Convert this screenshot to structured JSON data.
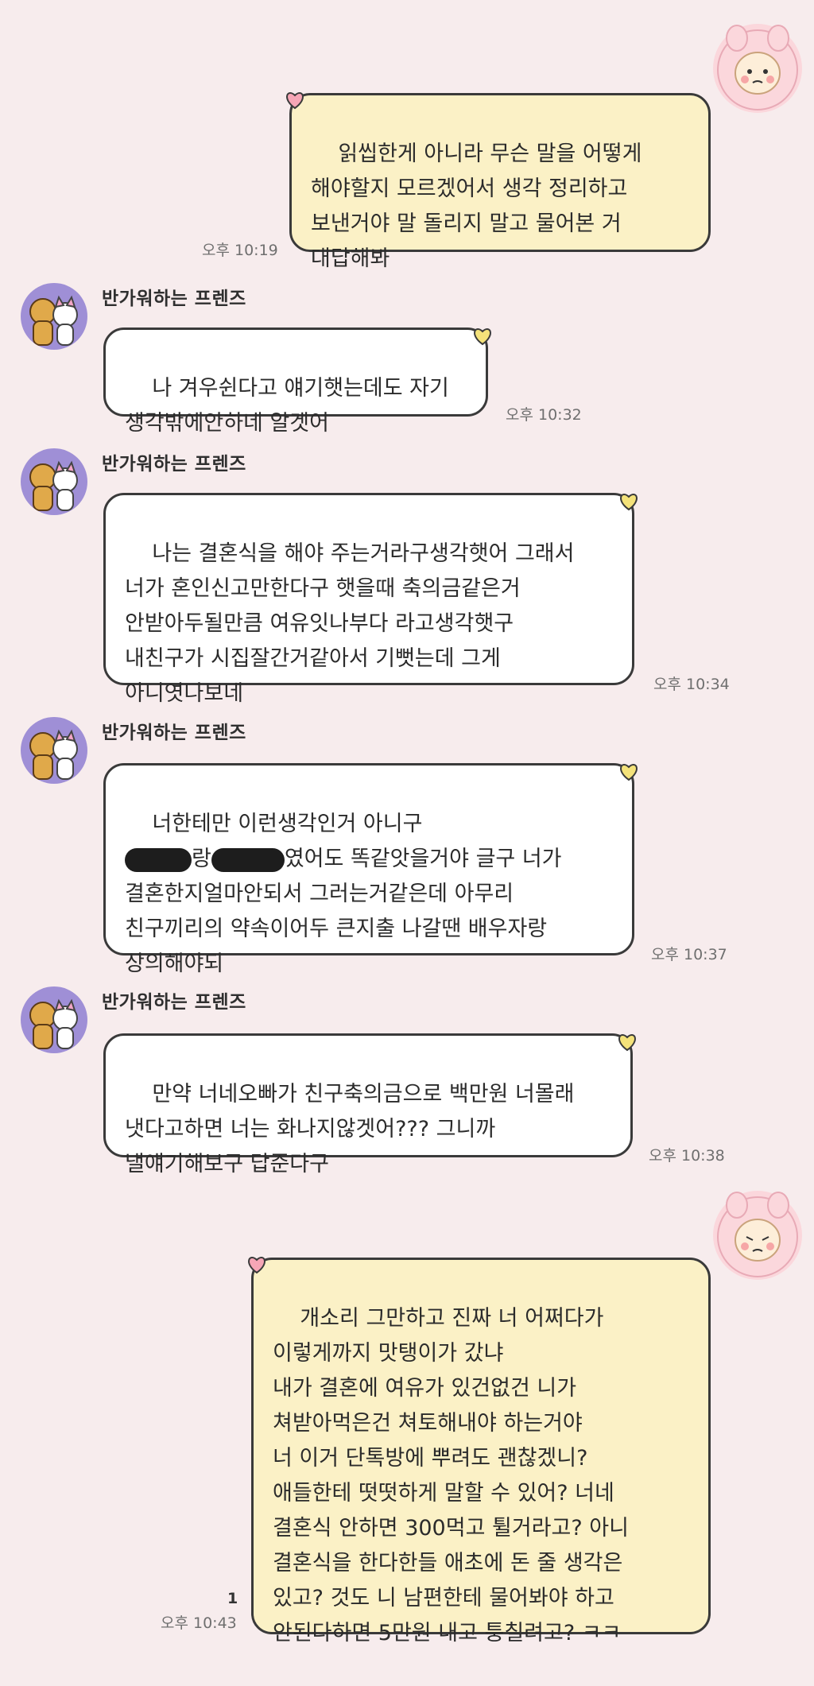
{
  "colors": {
    "background": "#f7eced",
    "my_bubble": "#fbf1c6",
    "friend_bubble": "#ffffff",
    "avatar_friend_bg": "#9f8fd6",
    "avatar_me_bg": "#fbd7dc",
    "heart_me": "#f6a6b6",
    "heart_friend": "#f4e27a"
  },
  "messages": [
    {
      "sender": "me",
      "avatar_icon": "pink-bunny-avatar-icon",
      "text": "읽씹한게 아니라 무슨 말을 어떻게\n해야할지 모르겠어서 생각 정리하고\n보낸거야 말 돌리지 말고 물어본 거\n대답해봐",
      "time": "오후 10:19"
    },
    {
      "sender": "friend",
      "name": "반가워하는 프렌즈",
      "avatar_icon": "friends-avatar-icon",
      "text": "나 겨우쉰다고 얘기햇는데도 자기\n생각밖에안하네 알겟어",
      "time": "오후 10:32"
    },
    {
      "sender": "friend",
      "name": "반가워하는 프렌즈",
      "avatar_icon": "friends-avatar-icon",
      "text": "나는 결혼식을 해야 주는거라구생각햇어 그래서\n너가 혼인신고만한다구 햇을때 축의금같은거\n안받아두될만큼 여유잇나부다 라고생각햇구\n내친구가 시집잘간거같아서 기뻣는데 그게\n아니엿나보네",
      "time": "오후 10:34"
    },
    {
      "sender": "friend",
      "name": "반가워하는 프렌즈",
      "avatar_icon": "friends-avatar-icon",
      "text_line1": "너한테만 이런생각인거 아니구",
      "text_line2_mid": "랑",
      "text_line2_end": "였어도 똑같앗을거야 글구 너가",
      "text_rest": "결혼한지얼마안되서 그러는거같은데 아무리\n친구끼리의 약속이어두 큰지출 나갈땐 배우자랑\n상의해야되",
      "time": "오후 10:37"
    },
    {
      "sender": "friend",
      "name": "반가워하는 프렌즈",
      "avatar_icon": "friends-avatar-icon",
      "text": "만약 너네오빠가 친구축의금으로 백만원 너몰래\n냇다고하면 너는 화나지않겟어??? 그니까\n낼얘기해보구 답준다구",
      "time": "오후 10:38"
    },
    {
      "sender": "me",
      "avatar_icon": "pink-bunny-avatar-icon",
      "text": "개소리 그만하고 진짜 너 어쩌다가\n이렇게까지 맛탱이가 갔냐\n내가 결혼에 여유가 있건없건 니가\n쳐받아먹은건 쳐토해내야 하는거야\n너 이거 단톡방에 뿌려도 괜찮겠니?\n애들한테 떳떳하게 말할 수 있어? 너네\n결혼식 안하면 300먹고 튈거라고? 아니\n결혼식을 한다한들 애초에 돈 줄 생각은\n있고? 것도 니 남편한테 물어봐야 하고\n안된다하면 5만원 내고 퉁칠려고? ㅋㅋ",
      "time": "오후 10:43",
      "unread_count": "1"
    }
  ]
}
